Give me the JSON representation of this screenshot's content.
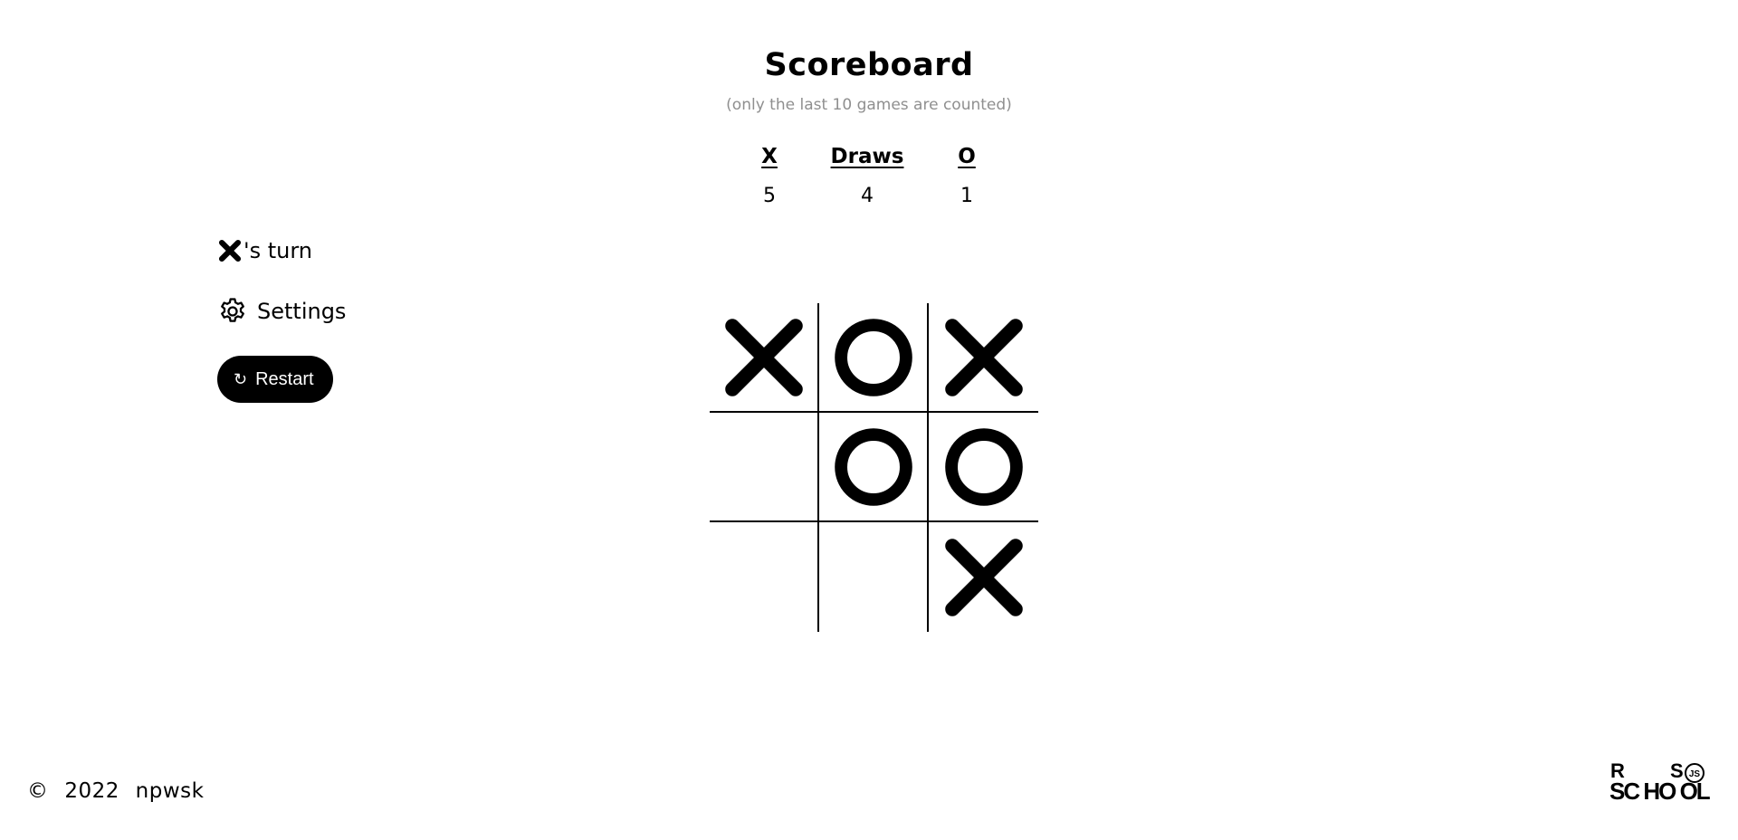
{
  "scoreboard": {
    "title": "Scoreboard",
    "subtitle": "(only the last 10 games are counted)",
    "columns": [
      {
        "label": "X",
        "value": "5"
      },
      {
        "label": "Draws",
        "value": "4"
      },
      {
        "label": "O",
        "value": "1"
      }
    ]
  },
  "turn": {
    "player": "X",
    "label": "'s turn"
  },
  "settings": {
    "label": "Settings",
    "icon": "gear-icon"
  },
  "restart": {
    "label": "Restart",
    "icon": "↻"
  },
  "board": {
    "cells": [
      "X",
      "O",
      "X",
      "",
      "O",
      "O",
      "",
      "",
      "X"
    ]
  },
  "footer": {
    "copyright": "©",
    "year": "2022",
    "author": "npwsk"
  },
  "logo": {
    "text": "RS SCHOOL JS"
  }
}
